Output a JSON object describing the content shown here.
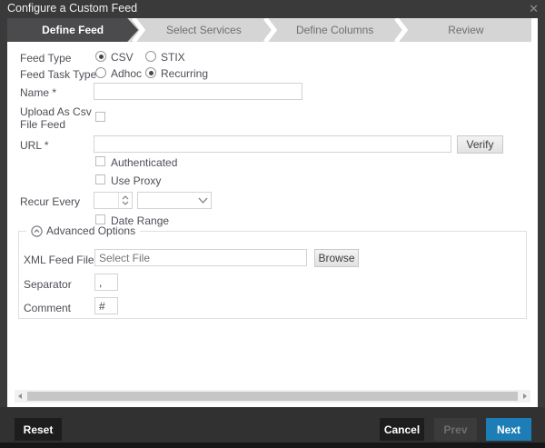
{
  "window": {
    "title": "Configure a Custom Feed",
    "close_icon": "✕"
  },
  "wizard": {
    "steps": [
      {
        "label": "Define Feed",
        "active": true
      },
      {
        "label": "Select Services",
        "active": false
      },
      {
        "label": "Define Columns",
        "active": false
      },
      {
        "label": "Review",
        "active": false
      }
    ]
  },
  "form": {
    "feed_type": {
      "label": "Feed Type",
      "options": [
        {
          "label": "CSV",
          "selected": true
        },
        {
          "label": "STIX",
          "selected": false
        }
      ]
    },
    "feed_task_type": {
      "label": "Feed Task Type",
      "options": [
        {
          "label": "Adhoc",
          "selected": false
        },
        {
          "label": "Recurring",
          "selected": true
        }
      ]
    },
    "name": {
      "label": "Name *",
      "value": ""
    },
    "upload_csv": {
      "label_line1": "Upload As Csv",
      "label_line2": "File Feed",
      "checked": false
    },
    "url": {
      "label": "URL *",
      "value": "",
      "verify_label": "Verify"
    },
    "authenticated": {
      "label": "Authenticated",
      "checked": false
    },
    "use_proxy": {
      "label": "Use Proxy",
      "checked": false
    },
    "recur_every": {
      "label": "Recur Every",
      "value": "",
      "unit_value": ""
    },
    "date_range": {
      "label": "Date Range",
      "checked": false
    },
    "advanced": {
      "legend": "Advanced Options",
      "expanded": true,
      "xml_feed_file": {
        "label": "XML Feed File",
        "placeholder": "Select File",
        "browse_label": "Browse"
      },
      "separator": {
        "label": "Separator",
        "value": ","
      },
      "comment": {
        "label": "Comment",
        "value": "#"
      }
    }
  },
  "footer": {
    "reset_label": "Reset",
    "cancel_label": "Cancel",
    "prev_label": "Prev",
    "prev_disabled": true,
    "next_label": "Next"
  },
  "colors": {
    "accent_blue": "#1d7db6",
    "titlebar": "#3a3a3b",
    "active_tab": "#4b4b4d",
    "wizard_bar": "#d5d5d5"
  }
}
